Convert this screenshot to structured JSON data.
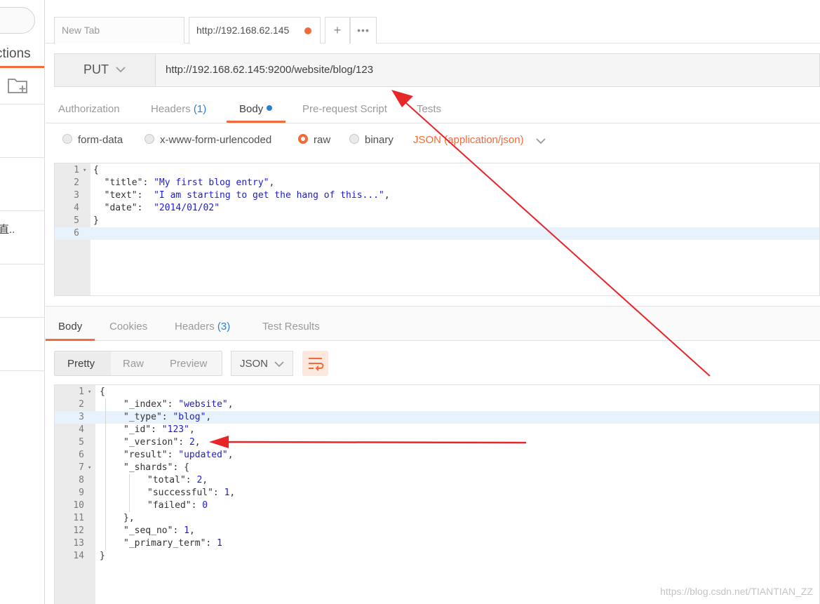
{
  "sidebar": {
    "tab_label": "ctions",
    "item_text": "直.."
  },
  "tabs": {
    "new_tab_label": "New Tab",
    "active_tab_label": "http://192.168.62.145",
    "plus_label": "+",
    "more_label": "•••"
  },
  "request": {
    "method": "PUT",
    "url": "http://192.168.62.145:9200/website/blog/123",
    "tabs": {
      "authorization": "Authorization",
      "headers": "Headers",
      "headers_count": "(1)",
      "body": "Body",
      "prerequest": "Pre-request Script",
      "tests": "Tests"
    },
    "body_types": {
      "form_data": "form-data",
      "urlencoded": "x-www-form-urlencoded",
      "raw": "raw",
      "binary": "binary",
      "content_type": "JSON (application/json)"
    },
    "body_lines": [
      {
        "n": "1",
        "fold": true,
        "text": "{"
      },
      {
        "n": "2",
        "key": "\"title\"",
        "sep": ": ",
        "val": "\"My first blog entry\"",
        "end": ","
      },
      {
        "n": "3",
        "key": "\"text\"",
        "sep": ":  ",
        "val": "\"I am starting to get the hang of this...\"",
        "end": ","
      },
      {
        "n": "4",
        "key": "\"date\"",
        "sep": ":  ",
        "val": "\"2014/01/02\"",
        "end": ""
      },
      {
        "n": "5",
        "text": "}"
      },
      {
        "n": "6",
        "text": ""
      }
    ]
  },
  "response": {
    "tabs": {
      "body": "Body",
      "cookies": "Cookies",
      "headers": "Headers",
      "headers_count": "(3)",
      "test_results": "Test Results"
    },
    "views": {
      "pretty": "Pretty",
      "raw": "Raw",
      "preview": "Preview"
    },
    "format": "JSON",
    "lines": [
      {
        "n": "1",
        "fold": true,
        "indent": 0,
        "text": "{"
      },
      {
        "n": "2",
        "indent": 1,
        "key": "\"_index\"",
        "val": "\"website\"",
        "vtype": "s",
        "end": ","
      },
      {
        "n": "3",
        "indent": 1,
        "key": "\"_type\"",
        "val": "\"blog\"",
        "vtype": "s",
        "end": ","
      },
      {
        "n": "4",
        "indent": 1,
        "key": "\"_id\"",
        "val": "\"123\"",
        "vtype": "s",
        "end": ","
      },
      {
        "n": "5",
        "indent": 1,
        "key": "\"_version\"",
        "val": "2",
        "vtype": "n",
        "end": ","
      },
      {
        "n": "6",
        "indent": 1,
        "key": "\"result\"",
        "val": "\"updated\"",
        "vtype": "s",
        "end": ","
      },
      {
        "n": "7",
        "fold": true,
        "indent": 1,
        "key": "\"_shards\"",
        "val": "{",
        "vtype": "k",
        "end": ""
      },
      {
        "n": "8",
        "indent": 2,
        "key": "\"total\"",
        "val": "2",
        "vtype": "n",
        "end": ","
      },
      {
        "n": "9",
        "indent": 2,
        "key": "\"successful\"",
        "val": "1",
        "vtype": "n",
        "end": ","
      },
      {
        "n": "10",
        "indent": 2,
        "key": "\"failed\"",
        "val": "0",
        "vtype": "n",
        "end": ""
      },
      {
        "n": "11",
        "indent": 1,
        "text": "},"
      },
      {
        "n": "12",
        "indent": 1,
        "key": "\"_seq_no\"",
        "val": "1",
        "vtype": "n",
        "end": ","
      },
      {
        "n": "13",
        "indent": 1,
        "key": "\"_primary_term\"",
        "val": "1",
        "vtype": "n",
        "end": ""
      },
      {
        "n": "14",
        "indent": 0,
        "text": "}"
      }
    ]
  },
  "watermark": "https://blog.csdn.net/TIANTIAN_ZZ",
  "colors": {
    "accent": "#f26b3a",
    "count_blue": "#2a7fd4",
    "annotation_red": "#e8262a"
  }
}
